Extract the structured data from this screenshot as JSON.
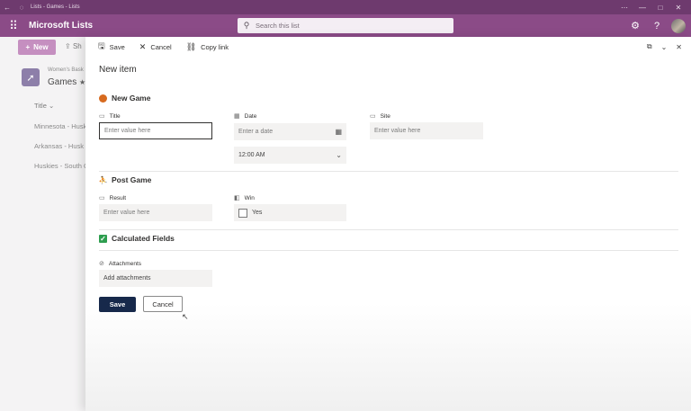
{
  "window": {
    "title": "Lists - Games - Lists",
    "controls": [
      "—",
      "□",
      "✕"
    ]
  },
  "suite": {
    "app_name": "Microsoft Lists",
    "search_placeholder": "Search this list"
  },
  "background_list": {
    "new_label": "New",
    "share_label": "Sh",
    "site_name": "Women's Bask",
    "list_name": "Games",
    "column_title": "Title",
    "rows": [
      "Minnesota - Husk",
      "Arkansas - Husk",
      "Huskies - South C"
    ]
  },
  "panel": {
    "commands": {
      "save": "Save",
      "cancel": "Cancel",
      "copy_link": "Copy link"
    },
    "title": "New item",
    "sections": {
      "new_game": "New Game",
      "post_game": "Post Game",
      "calculated": "Calculated Fields"
    },
    "fields": {
      "title": {
        "label": "Title",
        "placeholder": "Enter value here"
      },
      "date": {
        "label": "Date",
        "placeholder": "Enter a date",
        "time": "12:00 AM"
      },
      "site": {
        "label": "Site",
        "placeholder": "Enter value here"
      },
      "result": {
        "label": "Result",
        "placeholder": "Enter value here"
      },
      "win": {
        "label": "Win",
        "value": "Yes"
      },
      "attachments": {
        "label": "Attachments",
        "action": "Add attachments"
      }
    },
    "buttons": {
      "save": "Save",
      "cancel": "Cancel"
    }
  }
}
